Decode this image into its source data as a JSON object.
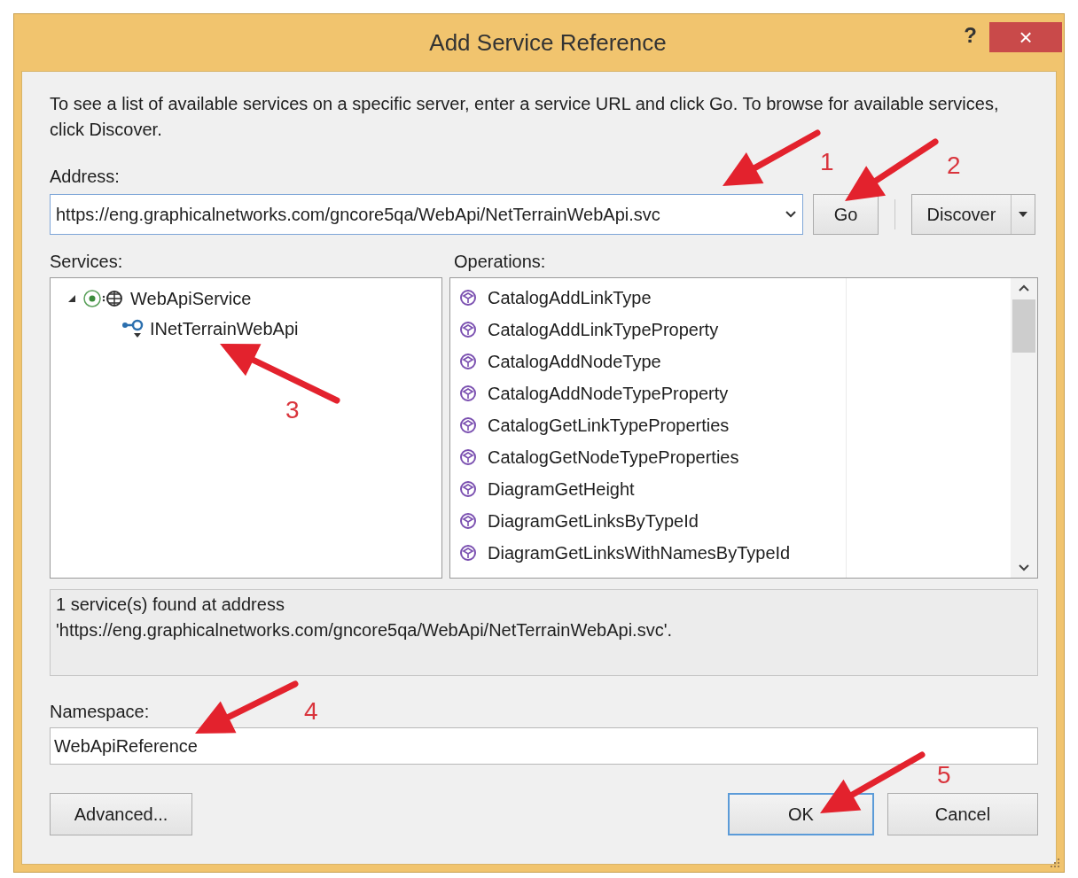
{
  "window": {
    "title": "Add Service Reference",
    "help": "?",
    "close": "×"
  },
  "description": "To see a list of available services on a specific server, enter a service URL and click Go. To browse for available services, click Discover.",
  "address": {
    "label": "Address:",
    "value": "https://eng.graphicalnetworks.com/gncore5qa/WebApi/NetTerrainWebApi.svc"
  },
  "go_button": "Go",
  "discover_button": "Discover",
  "services": {
    "label": "Services:",
    "tree": [
      {
        "label": "WebApiService",
        "expanded": true,
        "children": [
          {
            "label": "INetTerrainWebApi"
          }
        ]
      }
    ]
  },
  "operations": {
    "label": "Operations:",
    "items": [
      "CatalogAddLinkType",
      "CatalogAddLinkTypeProperty",
      "CatalogAddNodeType",
      "CatalogAddNodeTypeProperty",
      "CatalogGetLinkTypeProperties",
      "CatalogGetNodeTypeProperties",
      "DiagramGetHeight",
      "DiagramGetLinksByTypeId",
      "DiagramGetLinksWithNamesByTypeId"
    ]
  },
  "status": "1 service(s) found at address\n'https://eng.graphicalnetworks.com/gncore5qa/WebApi/NetTerrainWebApi.svc'.",
  "namespace": {
    "label": "Namespace:",
    "value": "WebApiReference"
  },
  "footer_buttons": [
    {
      "label": "Advanced...",
      "focused": false
    },
    {
      "label": "OK",
      "focused": true
    },
    {
      "label": "Cancel",
      "focused": false
    }
  ],
  "annotations": [
    {
      "label": "1"
    },
    {
      "label": "2"
    },
    {
      "label": "3"
    },
    {
      "label": "4"
    },
    {
      "label": "5"
    }
  ]
}
